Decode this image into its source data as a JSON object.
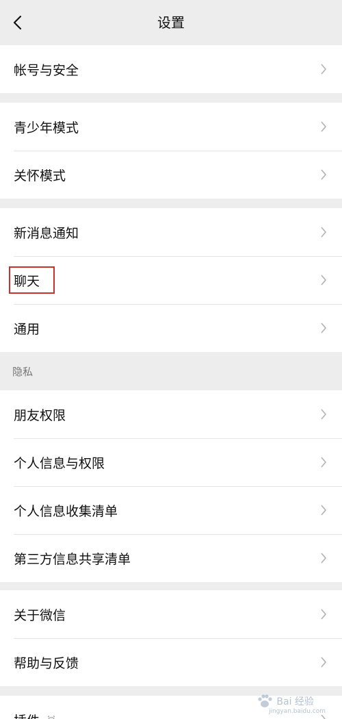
{
  "header": {
    "title": "设置",
    "back_icon": "chevron-left-icon"
  },
  "groups": {
    "account": [
      "帐号与安全"
    ],
    "modes": [
      "青少年模式",
      "关怀模式"
    ],
    "features": [
      "新消息通知",
      "聊天",
      "通用"
    ],
    "privacy_header": "隐私",
    "privacy": [
      "朋友权限",
      "个人信息与权限",
      "个人信息收集清单",
      "第三方信息共享清单"
    ],
    "about": [
      "关于微信",
      "帮助与反馈"
    ],
    "plugins": "插件"
  },
  "watermark": {
    "text": "Bai 经验",
    "url": "jingyan.baidu.com"
  },
  "colors": {
    "background": "#ededed",
    "card": "#ffffff",
    "highlight": "#c9302c"
  }
}
